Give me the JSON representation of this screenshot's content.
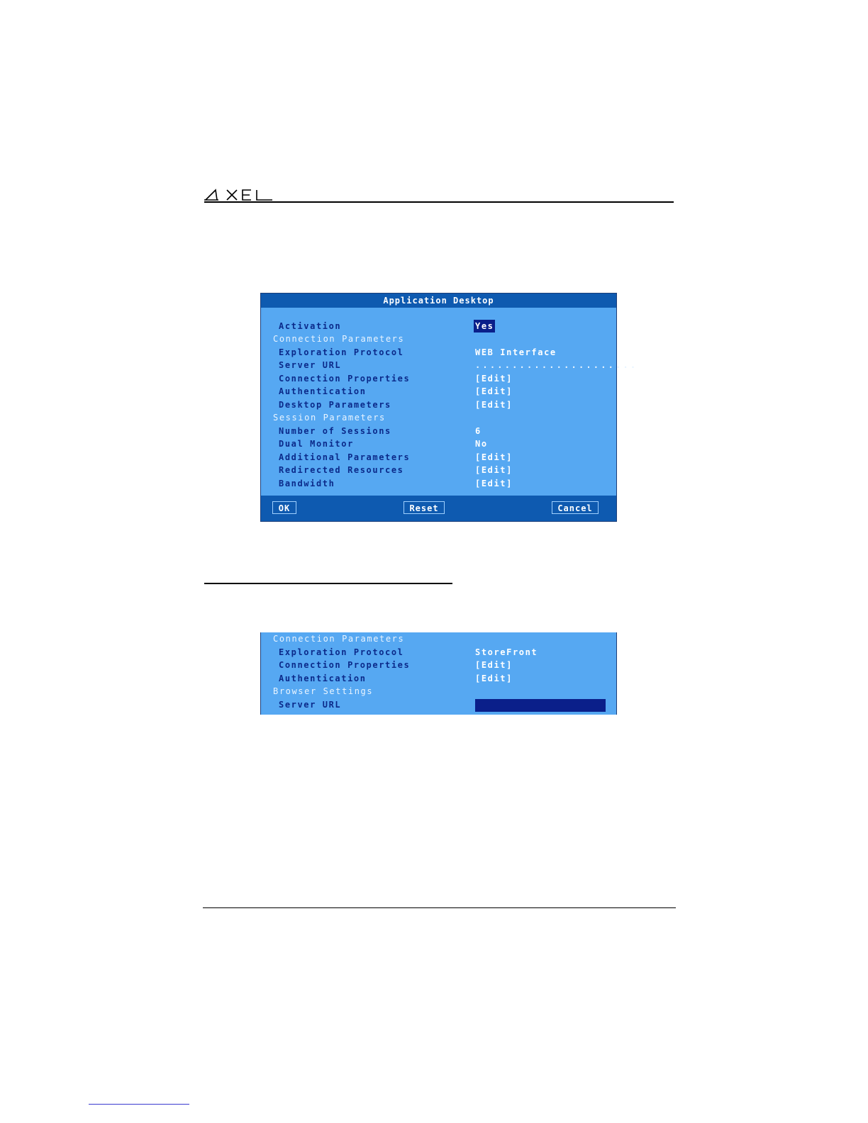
{
  "header": {
    "logo": "AXEL"
  },
  "dialog1": {
    "title": "Application Desktop",
    "rows": [
      {
        "label": "Activation",
        "value": "Yes",
        "section": false
      },
      {
        "label": "Connection Parameters",
        "value": "",
        "section": true
      },
      {
        "label": "Exploration Protocol",
        "value": "WEB Interface",
        "section": false
      },
      {
        "label": "Server URL",
        "value": "......................",
        "section": false
      },
      {
        "label": "Connection Properties",
        "value": "[Edit]",
        "section": false
      },
      {
        "label": "Authentication",
        "value": "[Edit]",
        "section": false
      },
      {
        "label": "Desktop Parameters",
        "value": "[Edit]",
        "section": false
      },
      {
        "label": "Session Parameters",
        "value": "",
        "section": true
      },
      {
        "label": "Number of Sessions",
        "value": "6",
        "section": false
      },
      {
        "label": "Dual Monitor",
        "value": "No",
        "section": false
      },
      {
        "label": "Additional Parameters",
        "value": "[Edit]",
        "section": false
      },
      {
        "label": "Redirected Resources",
        "value": "[Edit]",
        "section": false
      },
      {
        "label": "Bandwidth",
        "value": "[Edit]",
        "section": false
      }
    ],
    "buttons": {
      "ok": "OK",
      "reset": "Reset",
      "cancel": "Cancel"
    }
  },
  "dialog2": {
    "rows": [
      {
        "label": "Connection Parameters",
        "value": "",
        "section": true
      },
      {
        "label": "Exploration Protocol",
        "value": "StoreFront",
        "section": false
      },
      {
        "label": "Connection Properties",
        "value": "[Edit]",
        "section": false
      },
      {
        "label": "Authentication",
        "value": "[Edit]",
        "section": false
      },
      {
        "label": "Browser Settings",
        "value": "",
        "section": true
      },
      {
        "label": "Server URL",
        "value": "",
        "section": false
      }
    ],
    "server_url_value": ""
  },
  "colors": {
    "dialog_bg": "#56a8f2",
    "title_bar": "#0e5ab0",
    "label_text": "#0b2a8a",
    "highlight": "#0a1f8a"
  }
}
